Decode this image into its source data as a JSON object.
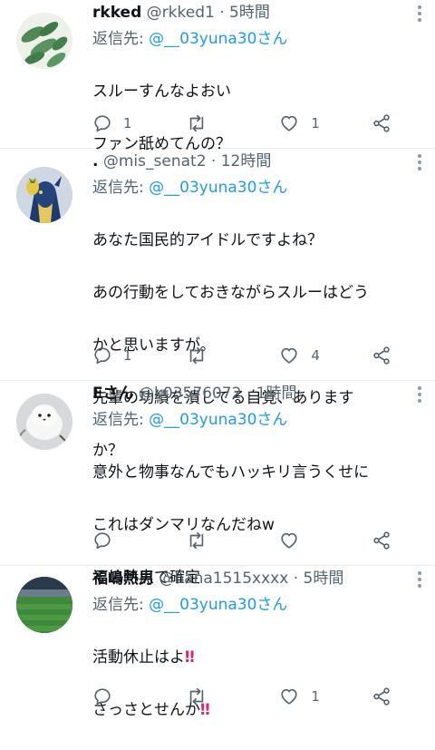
{
  "tweets": [
    {
      "name": "rkked",
      "handle": "@rkked1",
      "sep": "·",
      "time": "5時間",
      "reply_prefix": "返信先: ",
      "reply_to": "@__03yuna30さん",
      "text_lines": [
        "スルーすんなよおい",
        "ファン舐めてんの？"
      ],
      "counts": {
        "reply": "1",
        "retweet": "",
        "like": "1"
      }
    },
    {
      "name": ".",
      "handle": "@mis_senat2",
      "sep": "·",
      "time": "12時間",
      "reply_prefix": "返信先: ",
      "reply_to": "@__03yuna30さん",
      "text_lines": [
        "あなた国民的アイドルですよね？",
        "あの行動をしておきながらスルーはどう",
        "かと思いますが。",
        "先輩の功績を潰してる自覚、あります",
        "か？"
      ],
      "counts": {
        "reply": "1",
        "retweet": "",
        "like": "4"
      }
    },
    {
      "name": "Eさん",
      "handle": "@k03576072",
      "sep": "·",
      "time": "1時間",
      "reply_prefix": "返信先: ",
      "reply_to": "@__03yuna30さん",
      "text_lines": [
        "意外と物事なんでもハッキリ言うくせに",
        "これはダンマリなんだねw",
        "その時点で確定"
      ],
      "counts": {
        "reply": "",
        "retweet": "",
        "like": ""
      }
    },
    {
      "name": "福嶋熱男",
      "handle": "@hana1515xxxx",
      "sep": "·",
      "time": "5時間",
      "reply_prefix": "返信先: ",
      "reply_to": "@__03yuna30さん",
      "text_lines": [
        "活動休止はよ",
        "さっさとせんか"
      ],
      "emoji": "‼",
      "counts": {
        "reply": "",
        "retweet": "",
        "like": "1"
      }
    }
  ],
  "colors": {
    "accent": "#1d9bf0",
    "muted": "#536471",
    "emoji": "#e0245e"
  },
  "icons": [
    "reply-icon",
    "retweet-icon",
    "like-icon",
    "share-icon",
    "more-icon"
  ]
}
